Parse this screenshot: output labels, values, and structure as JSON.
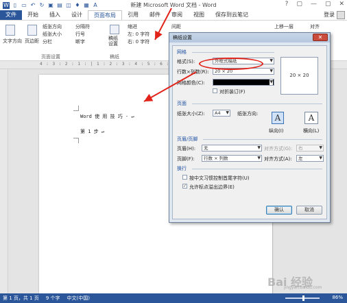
{
  "window": {
    "title": "新建 Microsoft Word 文档 - Word",
    "controls": [
      "?",
      "▢",
      "—",
      "▢",
      "✕"
    ]
  },
  "ribbon_tabs": [
    "文件",
    "开始",
    "插入",
    "设计",
    "页面布局",
    "引用",
    "邮件",
    "审阅",
    "视图",
    "保存到云笔记"
  ],
  "active_tab_index": 4,
  "login_label": "登录",
  "ribbon": {
    "text_direction": "文字方向",
    "margins": "页边距",
    "orientation": "纸张方向",
    "size": "纸张大小",
    "columns": "分栏",
    "breaks": "分隔符",
    "line_numbers": "行号",
    "hyphenation": "断字",
    "manuscript": "稿纸\n设置",
    "indent_label": "缩进",
    "indent_left": "左: 0 字符",
    "indent_right": "右: 0 字符",
    "spacing_label": "间距",
    "bring_forward": "上移一层",
    "align": "对齐",
    "group_page_setup": "页面设置",
    "group_manuscript": "稿纸"
  },
  "ruler_text": "4 : 3 : 2 : 1 : | 1 : 2 : 3 : 4 : 5 : 6 : 7 : 8 : 9",
  "document": {
    "line1": "Word 使 用 技 巧 - ↵",
    "line2": "第  1  步 ↵"
  },
  "status": {
    "page": "第 1 页，共 1 页",
    "words": "9 个字",
    "lang": "中文(中国)",
    "zoom": "86%"
  },
  "dialog": {
    "title": "稿纸设置",
    "section_grid": "网格",
    "format_label": "格式(S):",
    "format_value": "外框式稿纸",
    "rowcol_label": "行数×列数(R):",
    "rowcol_value": "20 × 20",
    "gridcolor_label": "网格颜色(C):",
    "facing_label": "对折装订(F)",
    "preview_text": "20 × 20",
    "section_page": "页面",
    "papersize_label": "纸张大小(Z):",
    "papersize_value": "A4",
    "orientation_label": "纸张方向:",
    "portrait_label": "纵向(I)",
    "landscape_label": "横向(L)",
    "section_headerfooter": "页眉/页脚",
    "header_label": "页眉(H):",
    "header_value": "无",
    "header_align_label": "对齐方式(G):",
    "header_align_value": "右",
    "footer_label": "页脚(F):",
    "footer_value": "行数 × 列数",
    "footer_align_label": "对齐方式(A):",
    "footer_align_value": "左",
    "section_wrap": "换行",
    "wrap1_label": "按中文习惯控制首尾字符(U)",
    "wrap2_label": "允许标点溢出边界(E)",
    "ok": "确认",
    "cancel": "取消"
  },
  "watermark": {
    "main": "Bai 经验",
    "sub": "jingyan.baidu.com"
  },
  "colors": {
    "word_blue": "#2b579a",
    "annotation_red": "#e2231a"
  }
}
